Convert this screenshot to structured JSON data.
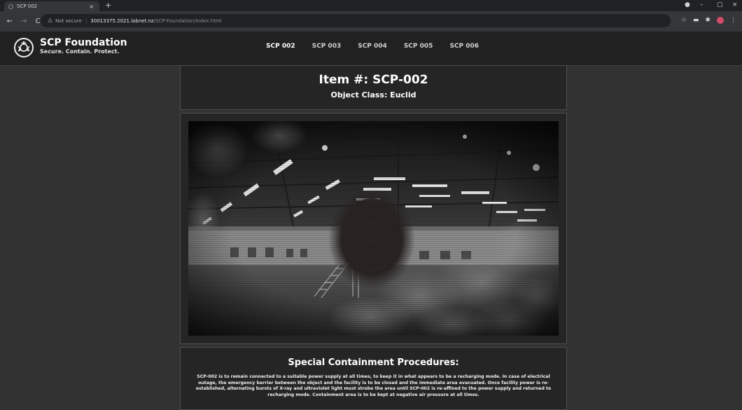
{
  "browser": {
    "tab_title": "SCP 002",
    "tab_close": "×",
    "new_tab": "+",
    "security_label": "Not secure",
    "url_host": "30013375.2021.labnet.nz",
    "url_path": "/SCP-Foundation/index.html",
    "window_controls": [
      "–",
      "▢",
      "×"
    ]
  },
  "site": {
    "name": "SCP Foundation",
    "tagline": "Secure. Contain. Protect.",
    "nav": [
      {
        "label": "SCP 002",
        "active": true
      },
      {
        "label": "SCP 003",
        "active": false
      },
      {
        "label": "SCP 004",
        "active": false
      },
      {
        "label": "SCP 005",
        "active": false
      },
      {
        "label": "SCP 006",
        "active": false
      }
    ]
  },
  "item": {
    "title": "Item #: SCP-002",
    "object_class": "Object Class: Euclid"
  },
  "containment": {
    "heading": "Special Containment Procedures:",
    "body": "SCP-002 is to remain connected to a suitable power supply at all times, to keep it in what appears to be a recharging mode. In case of electrical outage, the emergency barrier between the object and the facility is to be closed and the immediate area evacuated. Once facility power is re-established, alternating bursts of X-ray and ultraviolet light must strobe the area until SCP-002 is re-affixed to the power supply and returned to recharging mode. Containment area is to be kept at negative air pressure at all times."
  },
  "colors": {
    "page_bg": "#323232",
    "panel_bg": "#252525",
    "nav_bg": "#212121",
    "text": "#ffffff"
  }
}
